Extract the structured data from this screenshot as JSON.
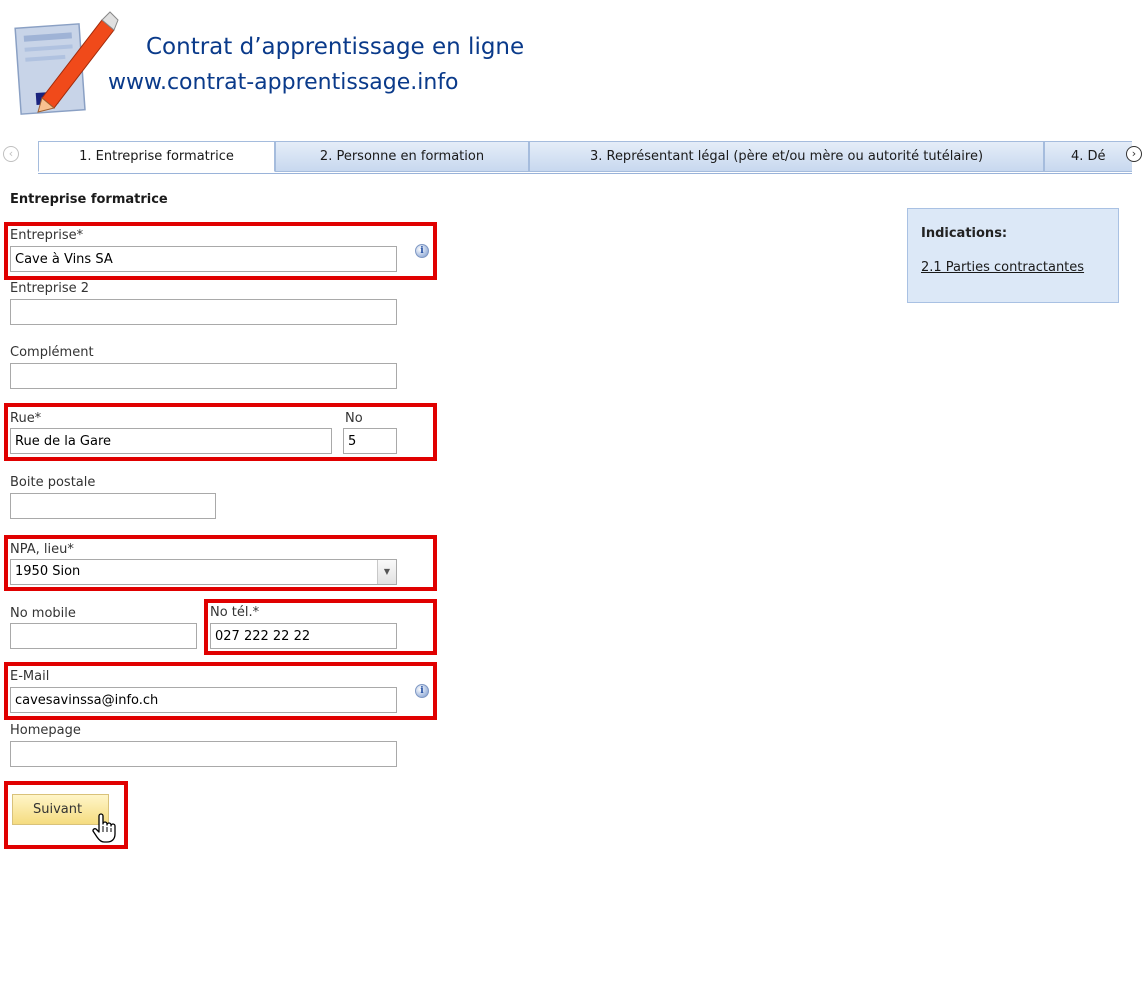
{
  "header": {
    "title": "Contrat d’apprentissage en ligne",
    "url": "www.contrat-apprentissage.info"
  },
  "tabs": [
    {
      "label": "1. Entreprise formatrice",
      "active": true
    },
    {
      "label": "2. Personne en formation",
      "active": false
    },
    {
      "label": "3. Représentant légal (père et/ou mère ou autorité tutélaire)",
      "active": false
    },
    {
      "label": "4. Dé",
      "active": false
    }
  ],
  "form": {
    "section_title": "Entreprise formatrice",
    "entreprise": {
      "label": "Entreprise*",
      "value": "Cave à Vins SA"
    },
    "entreprise2": {
      "label": "Entreprise 2",
      "value": ""
    },
    "complement": {
      "label": "Complément",
      "value": ""
    },
    "rue": {
      "label": "Rue*",
      "value": "Rue de la Gare"
    },
    "no": {
      "label": "No",
      "value": "5"
    },
    "boite_postale": {
      "label": "Boite postale",
      "value": ""
    },
    "npa_lieu": {
      "label": "NPA, lieu*",
      "value": "1950 Sion"
    },
    "no_mobile": {
      "label": "No mobile",
      "value": ""
    },
    "no_tel": {
      "label": "No tél.*",
      "value": "027 222 22 22"
    },
    "email": {
      "label": "E-Mail",
      "value": "cavesavinssa@info.ch"
    },
    "homepage": {
      "label": "Homepage",
      "value": ""
    },
    "next_button": "Suivant"
  },
  "indications": {
    "title": "Indications:",
    "link": "2.1 Parties contractantes"
  },
  "colors": {
    "brand": "#0a3a8a",
    "highlight": "#e00000",
    "panel": "#dce8f7",
    "button": "#f5dc80"
  }
}
